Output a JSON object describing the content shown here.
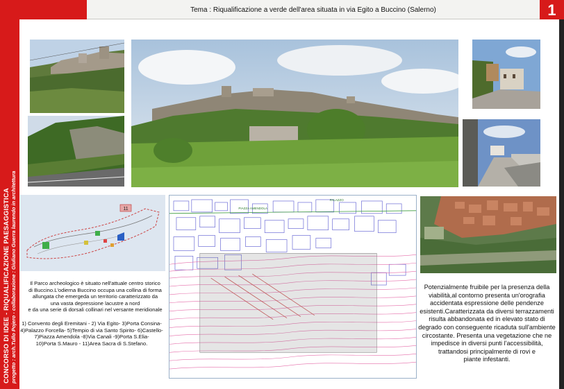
{
  "sidebar": {
    "title": "CONCORSO DI IDEE - RIQUALIFICAZIONE PAESAGGISTICA",
    "credits": "progetto : arch.Tullo Pojero - collaborazione : Giuliano Guerra laurendo in architettura"
  },
  "header": {
    "title": "Tema : Riqualificazione a verde dell'area situata in via Egito a Buccino (Salerno)",
    "page_number": "1"
  },
  "map": {
    "marker": "11",
    "street_label_1": "PIAZZA AMENDOLA",
    "street_label_2": "PALAZZO"
  },
  "caption": {
    "lines": [
      "Il Parco archeologico è situato nell'attuale centro storico",
      "di Buccino.L'odierna Buccino occupa una collina di forma",
      "allungata che emergeda un territorio caratterizzato da",
      "una vasta depressione lacustre a nord",
      "e da una serie di dorsali collinari nel versante meridionale"
    ]
  },
  "legend": {
    "lines": [
      "1) Convento degli Eremitani - 2) Via Egito- 3)Porta Consina-",
      "4)Palazzo Forcella- 5)Tempio di via Santo Spirito- 6)Castello-",
      "7)Piazza Amendola -8)Via Canali -9)Porta S.Elia-",
      "10)Porta S.Mauro - 11)Area Sacra di S.Stefano."
    ]
  },
  "description": {
    "lines": [
      "Potenzialmente fruibile per la presenza della",
      "viabilità,al contorno presenta un'orografia",
      "accidentata  espressione delle pendenze",
      "esistenti.Caratterizzata da diversi terrazzamenti",
      "risulta abbandonata ed in elevato stato di",
      "degrado con conseguente ricaduta sull'ambiente",
      "circostante. Presenta una vegetazione che ne",
      "impedisce in diversi punti l'accessibilità,",
      "trattandosi principalmente di rovi e",
      "piante infestanti."
    ]
  },
  "colors": {
    "accent_red": "#d71a1a",
    "header_band": "#f3f3f1",
    "plan_contours": "#e56aa8",
    "plan_buildings": "#6b6bd6"
  }
}
